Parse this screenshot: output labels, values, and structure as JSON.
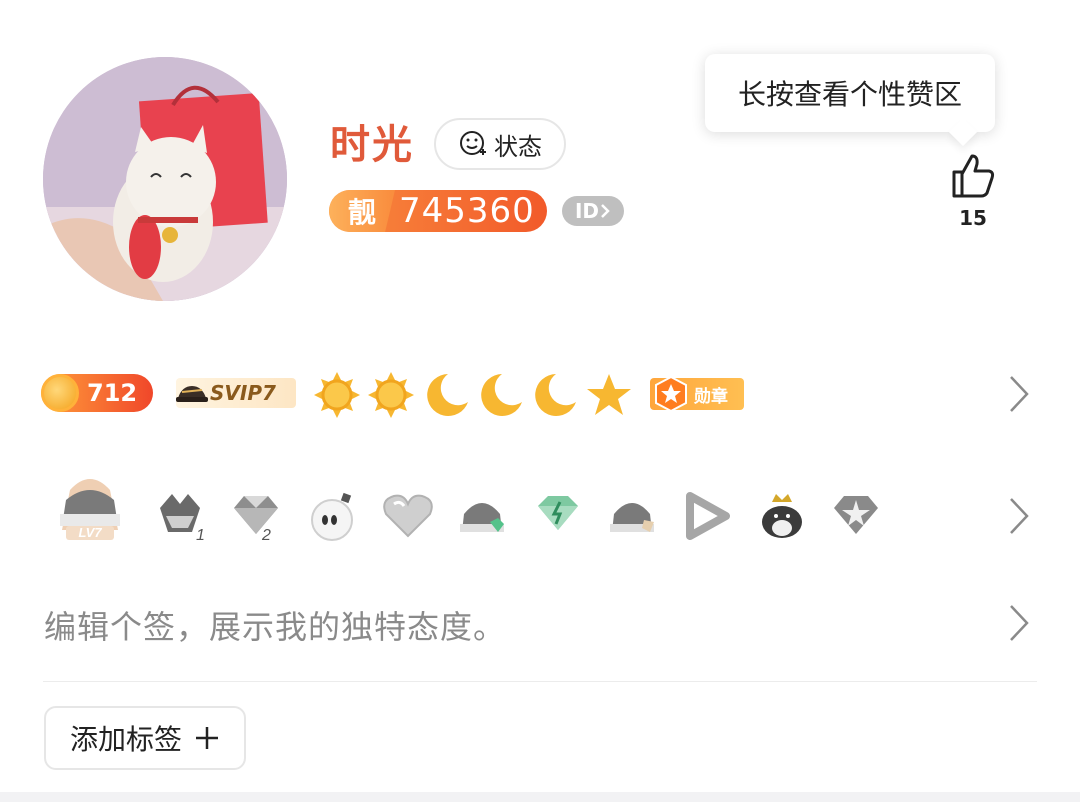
{
  "profile": {
    "nickname": "时光",
    "status_label": "状态",
    "liang_label": "靓",
    "qq_number": "745360",
    "id_label": "ID"
  },
  "tooltip": {
    "text": "长按查看个性赞区"
  },
  "like": {
    "count": "15"
  },
  "level_row": {
    "coin_value": "712",
    "svip_label": "SVIP7",
    "level_icons": [
      "sun-icon",
      "sun-icon",
      "moon-icon",
      "moon-icon",
      "moon-icon",
      "star-icon"
    ],
    "medal_label": "勋章"
  },
  "badges_row": {
    "badges": [
      {
        "icon": "penguin-lv7-badge-icon",
        "label": "LV7"
      },
      {
        "icon": "penguin-wings-badge-icon",
        "label": "1"
      },
      {
        "icon": "diamond-badge-icon",
        "label": "2"
      },
      {
        "icon": "bomb-badge-icon"
      },
      {
        "icon": "heart-badge-icon"
      },
      {
        "icon": "penguin-green-badge-icon"
      },
      {
        "icon": "green-diamond-badge-icon"
      },
      {
        "icon": "penguin-scarf-badge-icon"
      },
      {
        "icon": "play-badge-icon"
      },
      {
        "icon": "crowned-penguin-badge-icon"
      },
      {
        "icon": "star-gem-badge-icon"
      }
    ]
  },
  "signature": {
    "placeholder": "编辑个签，展示我的独特态度。"
  },
  "tags": {
    "add_label": "添加标签"
  },
  "colors": {
    "nickname": "#e05a3a",
    "accent_orange": "#f25a2a",
    "gold": "#f4a21c"
  }
}
